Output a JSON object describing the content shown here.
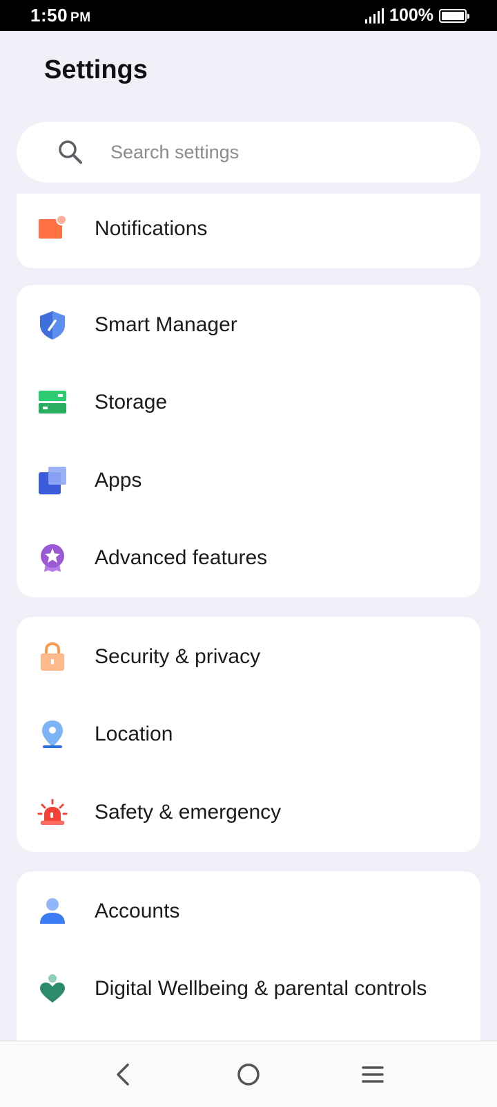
{
  "status_bar": {
    "time": "1:50",
    "ampm": "PM",
    "battery_percent": "100%",
    "battery_level": 1.0
  },
  "header": {
    "title": "Settings"
  },
  "search": {
    "placeholder": "Search settings",
    "icon": "search-icon"
  },
  "groups": [
    {
      "items": [
        {
          "label": "Notifications",
          "icon": "notifications-icon",
          "color": "#ff7043"
        }
      ]
    },
    {
      "items": [
        {
          "label": "Smart Manager",
          "icon": "shield-icon",
          "color": "#3f6fd8"
        },
        {
          "label": "Storage",
          "icon": "storage-icon",
          "color": "#2ecc71"
        },
        {
          "label": "Apps",
          "icon": "apps-icon",
          "color": "#3b5bdb"
        },
        {
          "label": "Advanced features",
          "icon": "star-badge-icon",
          "color": "#9b59d6"
        }
      ]
    },
    {
      "items": [
        {
          "label": "Security & privacy",
          "icon": "lock-icon",
          "color": "#ffab70"
        },
        {
          "label": "Location",
          "icon": "location-pin-icon",
          "color": "#5b9cf0"
        },
        {
          "label": "Safety & emergency",
          "icon": "siren-icon",
          "color": "#f44336"
        }
      ]
    },
    {
      "items": [
        {
          "label": "Accounts",
          "icon": "person-icon",
          "color": "#3d7cf5"
        },
        {
          "label": "Digital Wellbeing & parental controls",
          "icon": "wellbeing-heart-icon",
          "color": "#2e8b6e"
        }
      ]
    }
  ],
  "nav_bar": {
    "back": "back-icon",
    "home": "home-icon",
    "menu": "menu-icon"
  }
}
